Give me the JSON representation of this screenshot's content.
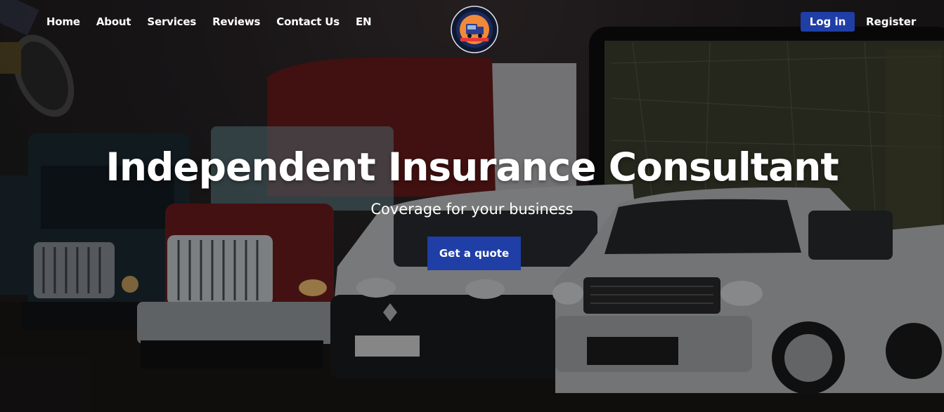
{
  "nav": {
    "links": [
      "Home",
      "About",
      "Services",
      "Reviews",
      "Contact Us",
      "EN"
    ],
    "login_label": "Log in",
    "register_label": "Register"
  },
  "logo": {
    "icon": "truck-badge-logo",
    "colors": {
      "ring": "#1a2a5a",
      "inner": "#f08a3a",
      "truck": "#2a3d8f"
    }
  },
  "hero": {
    "title": "Independent Insurance Consultant",
    "subtitle": "Coverage for your business",
    "cta_label": "Get a quote"
  },
  "colors": {
    "accent": "#1f3ea6",
    "text": "#ffffff"
  }
}
